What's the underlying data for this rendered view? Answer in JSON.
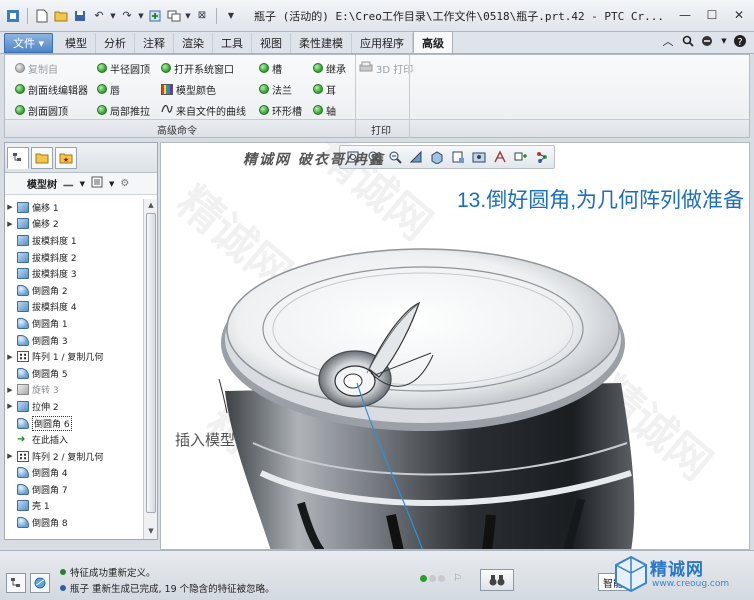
{
  "window": {
    "title": "瓶子 (活动的) E:\\Creo工作目录\\工作文件\\0518\\瓶子.prt.42 - PTC Cr..."
  },
  "ribbon": {
    "tabs": [
      "文件",
      "模型",
      "分析",
      "注释",
      "渲染",
      "工具",
      "视图",
      "柔性建模",
      "应用程序",
      "高级"
    ],
    "active_tab": "高级",
    "items": [
      {
        "label": "复制自",
        "icon": "grey-dot",
        "enabled": false
      },
      {
        "label": "剖面线编辑器",
        "icon": "green-dot",
        "enabled": true
      },
      {
        "label": "剖面圆顶",
        "icon": "green-dot",
        "enabled": true
      },
      {
        "label": "半径圆顶",
        "icon": "green-dot",
        "enabled": true
      },
      {
        "label": "唇",
        "icon": "green-dot",
        "enabled": true
      },
      {
        "label": "局部推拉",
        "icon": "green-dot",
        "enabled": true
      },
      {
        "label": "打开系统窗口",
        "icon": "green-dot",
        "enabled": true
      },
      {
        "label": "模型颜色",
        "icon": "color-palette-icon",
        "enabled": true
      },
      {
        "label": "来自文件的曲线",
        "icon": "curve-icon",
        "enabled": true
      },
      {
        "label": "槽",
        "icon": "green-dot",
        "enabled": true
      },
      {
        "label": "法兰",
        "icon": "green-dot",
        "enabled": true
      },
      {
        "label": "环形槽",
        "icon": "green-dot",
        "enabled": true
      },
      {
        "label": "继承",
        "icon": "green-dot",
        "enabled": true
      },
      {
        "label": "耳",
        "icon": "green-dot",
        "enabled": true
      },
      {
        "label": "轴",
        "icon": "green-dot",
        "enabled": true
      },
      {
        "label": "3D 打印",
        "icon": "printer-icon",
        "enabled": false
      }
    ],
    "group_labels": [
      "高级命令",
      "打印"
    ]
  },
  "model_tree": {
    "header_label": "模型树",
    "rows": [
      {
        "label": "偏移 1",
        "icon": "feat",
        "expandable": true,
        "dim": false
      },
      {
        "label": "偏移 2",
        "icon": "feat",
        "expandable": true,
        "dim": false
      },
      {
        "label": "拔模斜度 1",
        "icon": "feat",
        "expandable": false,
        "dim": false
      },
      {
        "label": "拔模斜度 2",
        "icon": "feat",
        "expandable": false,
        "dim": false
      },
      {
        "label": "拔模斜度 3",
        "icon": "feat",
        "expandable": false,
        "dim": false
      },
      {
        "label": "倒圆角 2",
        "icon": "round",
        "expandable": false,
        "dim": false
      },
      {
        "label": "拔模斜度 4",
        "icon": "feat",
        "expandable": false,
        "dim": false
      },
      {
        "label": "倒圆角 1",
        "icon": "round",
        "expandable": false,
        "dim": false
      },
      {
        "label": "倒圆角 3",
        "icon": "round",
        "expandable": false,
        "dim": false
      },
      {
        "label": "阵列 1 / 复制几何",
        "icon": "pattern",
        "expandable": true,
        "dim": false
      },
      {
        "label": "倒圆角 5",
        "icon": "round",
        "expandable": false,
        "dim": false
      },
      {
        "label": "旋转 3",
        "icon": "grey",
        "expandable": true,
        "dim": true
      },
      {
        "label": "拉伸 2",
        "icon": "feat",
        "expandable": true,
        "dim": false
      },
      {
        "label": "倒圆角 6",
        "icon": "round",
        "expandable": false,
        "dim": false,
        "selected": true
      },
      {
        "label": "在此插入",
        "icon": "insert",
        "expandable": false,
        "dim": false
      },
      {
        "label": "阵列 2 / 复制几何",
        "icon": "pattern",
        "expandable": true,
        "dim": false
      },
      {
        "label": "倒圆角 4",
        "icon": "round",
        "expandable": false,
        "dim": false
      },
      {
        "label": "倒圆角 7",
        "icon": "round",
        "expandable": false,
        "dim": false
      },
      {
        "label": "壳 1",
        "icon": "feat",
        "expandable": false,
        "dim": false
      },
      {
        "label": "倒圆角 8",
        "icon": "round",
        "expandable": false,
        "dim": false
      }
    ]
  },
  "graphics": {
    "brand_text": "精诚网 破衣哥/冉鑫",
    "annotation": "13.倒好圆角,为几何阵列做准备",
    "insert_label": "插入模型"
  },
  "status": {
    "messages": [
      "特征成功重新定义。",
      "瓶子 重新生成已完成, 19 个隐含的特征被忽略。"
    ],
    "smart_select": "智能"
  },
  "watermark_logo": {
    "name": "精诚网",
    "url": "www.creoug.com"
  },
  "colors": {
    "accent": "#2b78c6",
    "annotation": "#1a6fc4",
    "status_green": "#2c7d2c"
  }
}
